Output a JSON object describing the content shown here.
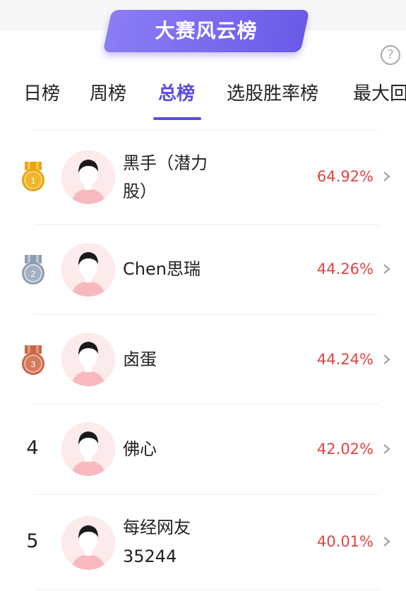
{
  "header": {
    "title": "大赛风云榜"
  },
  "tabs": [
    {
      "label": "日榜"
    },
    {
      "label": "周榜"
    },
    {
      "label": "总榜"
    },
    {
      "label": "选股胜率榜"
    },
    {
      "label": "最大回"
    }
  ],
  "active_tab": "总榜",
  "ranking": [
    {
      "rank": "1",
      "name": "黑手（潜力股）",
      "name_line1": "黑手（潜力",
      "name_line2": "股）",
      "percent": "64.92%",
      "medal": "gold"
    },
    {
      "rank": "2",
      "name": "Chen思瑞",
      "percent": "44.26%",
      "medal": "silver"
    },
    {
      "rank": "3",
      "name": "卤蛋",
      "percent": "44.24%",
      "medal": "bronze"
    },
    {
      "rank": "4",
      "name": "佛心",
      "percent": "42.02%"
    },
    {
      "rank": "5",
      "name": "每经网友35244",
      "name_line1": "每经网友",
      "name_line2": "35244",
      "percent": "40.01%"
    }
  ],
  "colors": {
    "accent": "#5b4de0",
    "percent": "#e04444",
    "gold": "#e8a317",
    "silver": "#8e9cb0",
    "bronze": "#c9674a"
  },
  "icons": {
    "help": "question-circle-icon",
    "chevron": "chevron-right-icon",
    "medal": "medal-icon"
  }
}
